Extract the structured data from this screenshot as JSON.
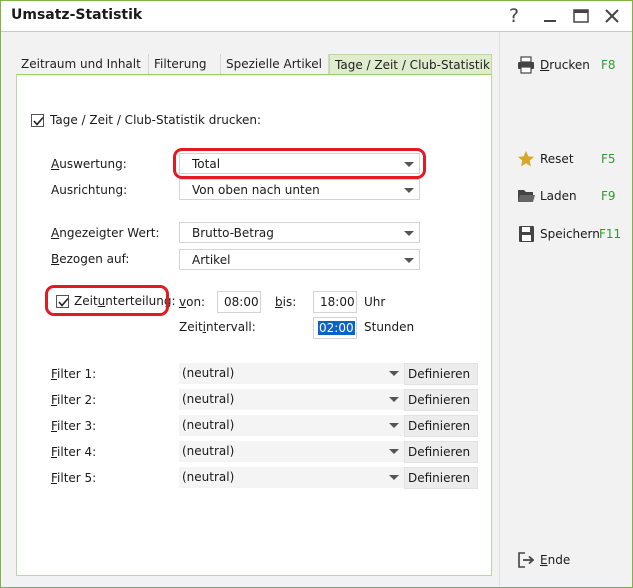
{
  "window": {
    "title": "Umsatz-Statistik"
  },
  "titlebar": {
    "help": "?",
    "minimize": "—",
    "maximize": "☐",
    "close": "✕"
  },
  "tabs": [
    {
      "label": "Zeitraum und Inhalt",
      "active": false
    },
    {
      "label": "Filterung",
      "active": false
    },
    {
      "label": "Spezielle Artikel",
      "active": false
    },
    {
      "label": "Tage / Zeit / Club-Statistik",
      "active": true
    }
  ],
  "print_option": {
    "label": "Tage / Zeit / Club-Statistik drucken:",
    "checked": true
  },
  "fields": {
    "auswertung": {
      "label_u": "A",
      "label_rest": "uswertung:",
      "value": "Total"
    },
    "ausrichtung": {
      "label": "Ausrichtung:",
      "value": "Von oben nach unten"
    },
    "angezeigter_wert": {
      "label_u": "A",
      "label_rest": "ngezeigter Wert:",
      "value": "Brutto-Betrag"
    },
    "bezogen_auf": {
      "label_u": "B",
      "label_rest": "ezogen auf:",
      "value": "Artikel"
    }
  },
  "zeit": {
    "checkbox_label_a": "Zeit",
    "checkbox_label_u": "u",
    "checkbox_label_b": "nterteilung:",
    "checked": true,
    "von_u": "v",
    "von_rest": "on:",
    "von_value": "08:00",
    "bis_u": "b",
    "bis_rest": "is:",
    "bis_value": "18:00",
    "uhr": "Uhr",
    "intervall_a": "Zeit",
    "intervall_u": "i",
    "intervall_b": "ntervall:",
    "intervall_value": "02:00",
    "stunden": "Stunden"
  },
  "filters": [
    {
      "label_u": "F",
      "label_rest": "ilter 1:",
      "value": "(neutral)",
      "button": "Definieren"
    },
    {
      "label_u": "F",
      "label_rest": "ilter 2:",
      "value": "(neutral)",
      "button": "Definieren"
    },
    {
      "label_u": "F",
      "label_rest": "ilter 3:",
      "value": "(neutral)",
      "button": "Definieren"
    },
    {
      "label_u": "F",
      "label_rest": "ilter 4:",
      "value": "(neutral)",
      "button": "Definieren"
    },
    {
      "label_u": "F",
      "label_rest": "ilter 5:",
      "value": "(neutral)",
      "button": "Definieren"
    }
  ],
  "actions": {
    "drucken": {
      "label_u": "D",
      "label_rest": "rucken",
      "key": "F8",
      "icon": "printer-icon"
    },
    "reset": {
      "label": "Reset",
      "key": "F5",
      "icon": "star-icon"
    },
    "laden": {
      "label": "Laden",
      "key": "F9",
      "icon": "folder-icon"
    },
    "speichern": {
      "label": "Speichern",
      "key": "F11",
      "icon": "save-icon"
    },
    "ende": {
      "label_u": "E",
      "label_rest": "nde",
      "icon": "exit-icon"
    }
  },
  "colors": {
    "accent_green": "#7cb342",
    "tab_active_bg": "#dfeccd",
    "highlight_red": "#e01b24",
    "shortcut_green": "#2e9b2e",
    "selection_blue": "#0a64c8"
  }
}
